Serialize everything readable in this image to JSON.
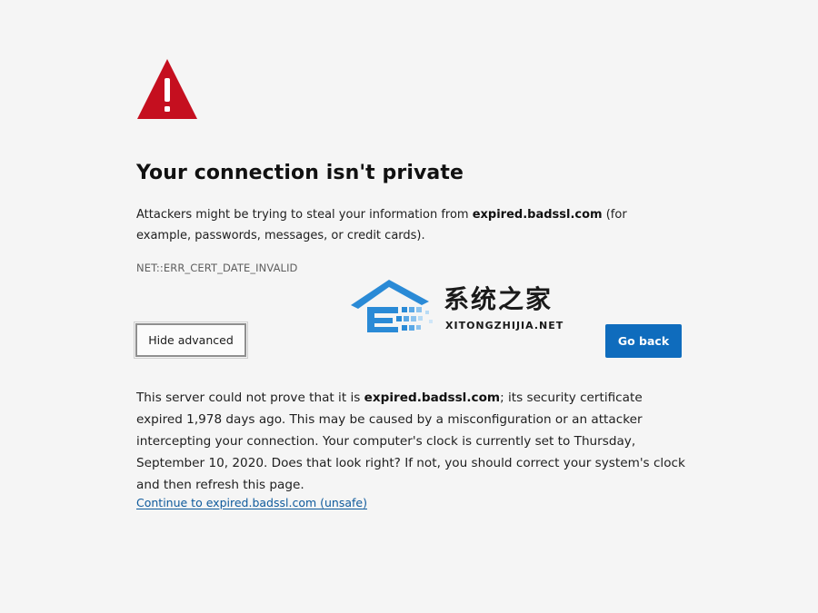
{
  "heading": {
    "title": "Your connection isn't private"
  },
  "intro": {
    "before": "Attackers might be trying to steal your information from ",
    "site": "expired.badssl.com",
    "after": " (for example, passwords, messages, or credit cards)."
  },
  "error_code": "NET::ERR_CERT_DATE_INVALID",
  "buttons": {
    "hide_advanced": "Hide advanced",
    "go_back": "Go back"
  },
  "advanced": {
    "before": "This server could not prove that it is ",
    "site": "expired.badssl.com",
    "after": "; its security certificate expired 1,978 days ago. This may be caused by a misconfiguration or an attacker intercepting your connection. Your computer's clock is currently set to Thursday, September 10, 2020. Does that look right? If not, you should correct your system's clock and then refresh this page."
  },
  "continue_link": "Continue to expired.badssl.com (unsafe)",
  "watermark": {
    "chinese": "系统之家",
    "latin": "XITONGZHIJIA.NET"
  },
  "icons": {
    "warning": "warning-triangle-icon",
    "watermark": "house-logo-icon"
  },
  "colors": {
    "background": "#f5f5f5",
    "warning_red": "#c50f1f",
    "primary_button": "#0f6cbd",
    "link": "#0e5a9c",
    "logo_blue": "#2a8ad6"
  }
}
